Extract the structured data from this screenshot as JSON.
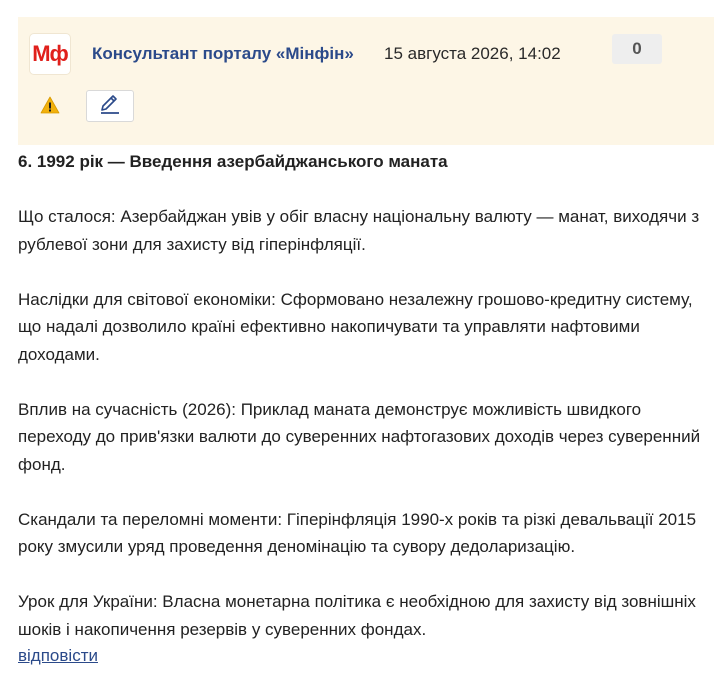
{
  "comment": {
    "logo_text": "Мф",
    "author": "Консультант порталу «Мінфін»",
    "date": "15 августа 2026, 14:02",
    "rating": "0",
    "warning_icon": "warning-triangle-icon",
    "edit_icon": "pencil-icon",
    "colors": {
      "header_bg": "#fdf6e6",
      "author": "#2b4a8a",
      "logo": "#e0201c",
      "warning": "#f2b10c",
      "link": "#2b4a8a"
    },
    "paragraphs": [
      "6. 1992 рік — Введення азербайджанського маната",
      "Що сталося: Азербайджан увів у обіг власну національну валюту — манат, виходячи з рублевої зони для захисту від гіперінфляції.",
      "Наслідки для світової економіки: Сформовано незалежну грошово-кредитну систему, що надалі дозволило країні ефективно накопичувати та управляти нафтовими доходами.",
      "Вплив на сучасність (2026): Приклад маната демонструє можливість швидкого переходу до прив'язки валюти до суверенних нафтогазових доходів через суверенний фонд.",
      "Скандали та переломні моменти: Гіперінфляція 1990-х років та різкі девальвації 2015 року змусили уряд проведення деномінацію та сувору дедоларизацію.",
      "Урок для України: Власна монетарна політика є необхідною для захисту від зовнішніх шоків і накопичення резервів у суверенних фондах."
    ],
    "reply_label": "відповісти"
  }
}
